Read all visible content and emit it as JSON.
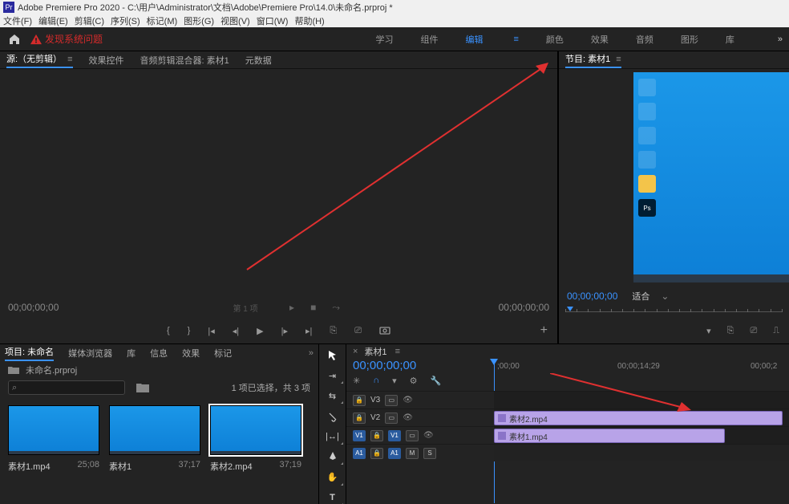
{
  "titlebar": {
    "text": "Adobe Premiere Pro 2020 - C:\\用户\\Administrator\\文档\\Adobe\\Premiere Pro\\14.0\\未命名.prproj *"
  },
  "menubar": [
    "文件(F)",
    "编辑(E)",
    "剪辑(C)",
    "序列(S)",
    "标记(M)",
    "图形(G)",
    "视图(V)",
    "窗口(W)",
    "帮助(H)"
  ],
  "warning": "发现系统问题",
  "workspaces": {
    "items": [
      "学习",
      "组件",
      "编辑",
      "颜色",
      "效果",
      "音频",
      "图形",
      "库"
    ],
    "activeIndex": 2,
    "more": "»"
  },
  "srcTabs": {
    "items": [
      "源:（无剪辑）",
      "效果控件",
      "音频剪辑混合器: 素材1",
      "元数据"
    ],
    "activeIndex": 0
  },
  "srcTc": {
    "left": "00;00;00;00",
    "right": "00;00;00;00",
    "fit": "第 1 项"
  },
  "progTab": "节目: 素材1",
  "progTc": {
    "tc": "00;00;00;00",
    "fit": "适合"
  },
  "projTabs": {
    "items": [
      "项目: 未命名",
      "媒体浏览器",
      "库",
      "信息",
      "效果",
      "标记"
    ],
    "activeIndex": 0
  },
  "projFile": "未命名.prproj",
  "selInfo": "1 项已选择，共 3 项",
  "clips": [
    {
      "name": "素材1.mp4",
      "dur": "25;08",
      "sel": false
    },
    {
      "name": "素材1",
      "dur": "37;17",
      "sel": false
    },
    {
      "name": "素材2.mp4",
      "dur": "37;19",
      "sel": true
    }
  ],
  "tlTab": "素材1",
  "tlTc": "00;00;00;00",
  "tlRuler": {
    "l0": ";00;00",
    "l1": "00;00;14;29",
    "l2": "00;00;2"
  },
  "tracks": {
    "v3": "V3",
    "v2": "V2",
    "v1": "V1",
    "a1": "A1",
    "clips": [
      {
        "name": "素材2.mp4",
        "row": 1
      },
      {
        "name": "素材1.mp4",
        "row": 2
      }
    ]
  }
}
